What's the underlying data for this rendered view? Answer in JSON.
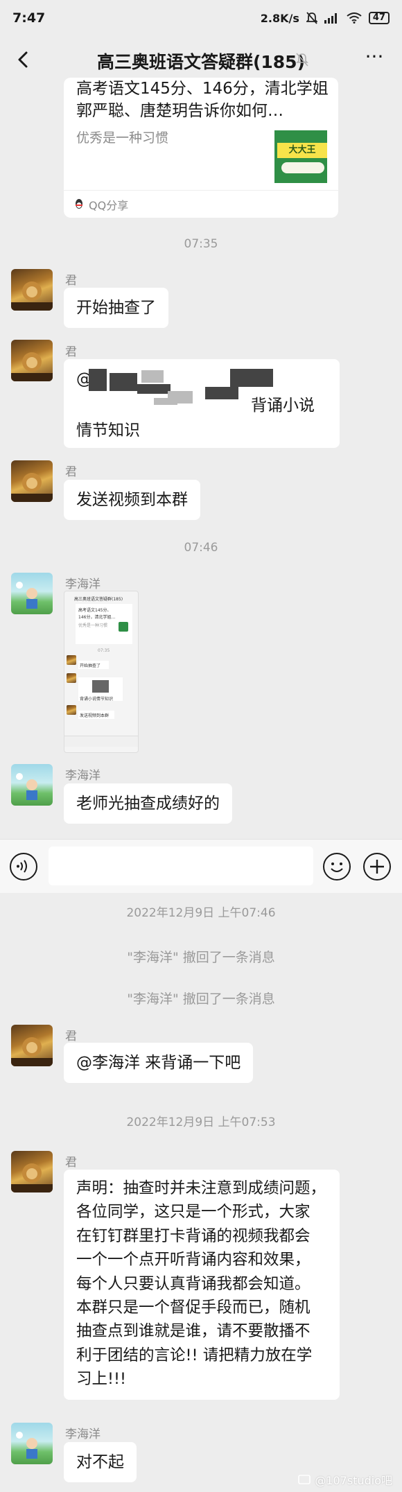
{
  "status_bar": {
    "time": "7:47",
    "net_speed": "2.8K/s",
    "battery": "47"
  },
  "header": {
    "title": "高三奥班语文答疑群(185)"
  },
  "share_card": {
    "title": "高考语文145分、146分，清北学姐郭严聪、唐楚玥告诉你如何…",
    "subtitle": "优秀是一种习惯",
    "thumb_text": "大大王",
    "source": "QQ分享"
  },
  "timestamps": {
    "t1": "07:35",
    "t2": "07:46",
    "t3": "2022年12月9日 上午07:46",
    "t4": "2022年12月9日 上午07:53"
  },
  "messages": {
    "m1": {
      "sender": "君",
      "text": "开始抽查了"
    },
    "m2": {
      "sender": "君",
      "mention": "@",
      "text_line1": "背诵小说",
      "text_line2": "情节知识"
    },
    "m3": {
      "sender": "君",
      "text": "发送视频到本群"
    },
    "m4": {
      "sender": "李海洋"
    },
    "m5": {
      "sender": "李海洋",
      "text": "老师光抽查成绩好的"
    },
    "m6": {
      "sender": "君",
      "text": "@李海洋  来背诵一下吧"
    },
    "m7": {
      "sender": "君",
      "lines": [
        "声明：抽查时并未注意到成绩问题，",
        "各位同学，这只是一个形式，大家",
        "在钉钉群里打卡背诵的视频我都会",
        "一个一个点开听背诵内容和效果，",
        "每个人只要认真背诵我都会知道。",
        "本群只是一个督促手段而已，随机",
        "抽查点到谁就是谁，请不要散播不",
        "利于团结的言论!! 请把精力放在学",
        "习上!!!"
      ]
    },
    "m8": {
      "sender": "李海洋",
      "text": "对不起"
    }
  },
  "recalls": {
    "r1": "\"李海洋\" 撤回了一条消息",
    "r2": "\"李海洋\" 撤回了一条消息"
  },
  "screenshot_preview": {
    "title": "高三奥班语文答疑群(185)",
    "card_line1": "高考语文145分、",
    "card_line2": "146分，清北学姐…",
    "card_sub": "优秀是一种习惯",
    "time": "07:35",
    "msg1": "开始抽查了",
    "msg2": "背诵小说情节知识",
    "msg3": "发送视频到本群"
  },
  "watermark": "@107studio吧"
}
